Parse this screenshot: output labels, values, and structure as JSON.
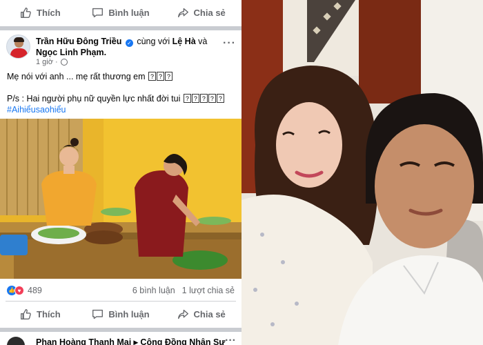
{
  "actions": {
    "like_label": "Thích",
    "comment_label": "Bình luận",
    "share_label": "Chia sẻ"
  },
  "post": {
    "author": "Trần Hữu Đông Triều",
    "with_text": "cùng với",
    "tagged_1": "Lệ Hà",
    "and_text": "và",
    "tagged_2": "Ngọc Linh Phạm.",
    "time": "1 giờ ·",
    "line1": "Mẹ nói với anh ... mẹ rất thương em",
    "line2": "P/s : Hai người phụ nữ quyền lực nhất đời tui",
    "hashtag": "#Aihiểusaohiểu"
  },
  "stats": {
    "reaction_count": "489",
    "comments": "6 bình luận",
    "shares": "1 lượt chia sẻ"
  },
  "next_post": {
    "text": "Phan Hoàng Thanh Mai ▸ Cộng Đồng Nhân Sự"
  },
  "icons": {
    "like": "thumbs-up-icon",
    "comment": "comment-bubble-icon",
    "share": "share-arrow-icon",
    "verified": "verified-badge-icon",
    "privacy": "globe-icon"
  },
  "colors": {
    "accent": "#1877f2",
    "muted_text": "#65676b",
    "love": "#f33e58",
    "separator": "#c9ccd1"
  }
}
